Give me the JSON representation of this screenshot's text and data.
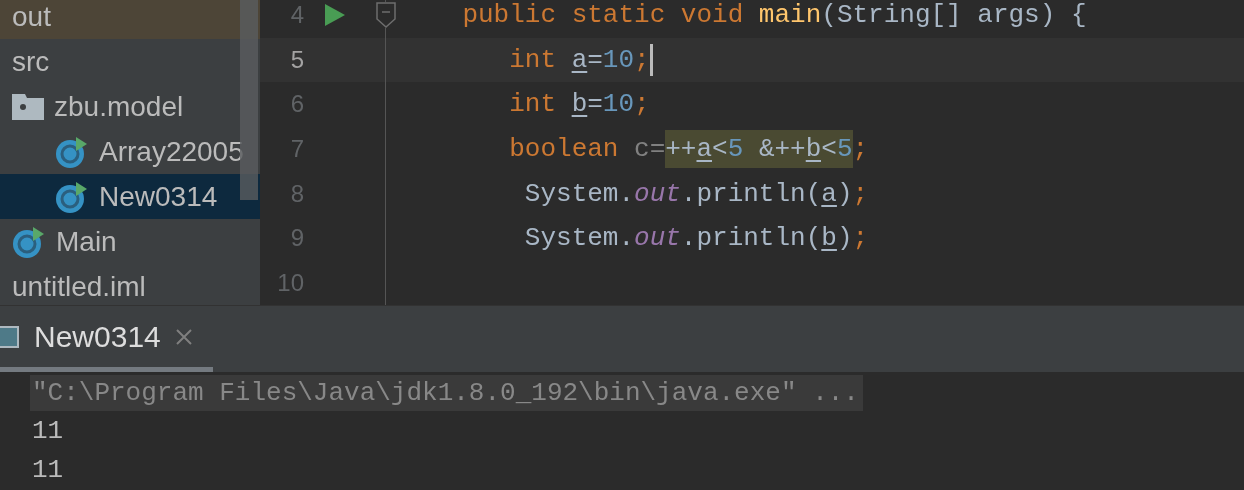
{
  "project_tree": [
    {
      "label": "out",
      "selected": false,
      "excluded": true
    },
    {
      "label": "src",
      "selected": false,
      "children": [
        {
          "label": "zbu.model",
          "kind": "package",
          "selected": false,
          "children": [
            {
              "label": "Array22005",
              "kind": "runnable-class",
              "selected": false
            },
            {
              "label": "New0314",
              "kind": "runnable-class",
              "selected": true
            }
          ]
        },
        {
          "label": "Main",
          "kind": "runnable-class",
          "selected": false
        }
      ]
    },
    {
      "label": "untitled.iml",
      "selected": false
    }
  ],
  "editor": {
    "lines": [
      {
        "number": "4",
        "run": true,
        "fold": true,
        "current": false,
        "tokens": [
          {
            "text": "    public static void ",
            "kind": "keyword"
          },
          {
            "text": "main",
            "kind": "method"
          },
          {
            "text": "(String[] args) {",
            "kind": "plain"
          }
        ]
      },
      {
        "number": "5",
        "current": true,
        "caret": true,
        "tokens": [
          {
            "text": "       int ",
            "kind": "keyword"
          },
          {
            "text": "a",
            "kind": "variable"
          },
          {
            "text": "=",
            "kind": "plain"
          },
          {
            "text": "10",
            "kind": "number"
          },
          {
            "text": ";",
            "kind": "punct"
          }
        ]
      },
      {
        "number": "6",
        "current": false,
        "tokens": [
          {
            "text": "       int ",
            "kind": "keyword"
          },
          {
            "text": "b",
            "kind": "variable"
          },
          {
            "text": "=",
            "kind": "plain"
          },
          {
            "text": "10",
            "kind": "number"
          },
          {
            "text": ";",
            "kind": "punct"
          }
        ]
      },
      {
        "number": "7",
        "current": false,
        "tokens": [
          {
            "text": "       boolean ",
            "kind": "keyword"
          },
          {
            "text": "c=",
            "kind": "unused"
          },
          {
            "text": "++",
            "kind": "plain",
            "highlight": true
          },
          {
            "text": "a",
            "kind": "variable",
            "highlight": true
          },
          {
            "text": "<",
            "kind": "plain",
            "highlight": true
          },
          {
            "text": "5",
            "kind": "number",
            "highlight": true
          },
          {
            "text": " &++",
            "kind": "plain",
            "highlight": true
          },
          {
            "text": "b",
            "kind": "variable",
            "highlight": true
          },
          {
            "text": "<",
            "kind": "plain",
            "highlight": true
          },
          {
            "text": "5",
            "kind": "number",
            "highlight": true
          },
          {
            "text": ";",
            "kind": "punct"
          }
        ]
      },
      {
        "number": "8",
        "current": false,
        "tokens": [
          {
            "text": "        System.",
            "kind": "plain"
          },
          {
            "text": "out",
            "kind": "field"
          },
          {
            "text": ".println(",
            "kind": "plain"
          },
          {
            "text": "a",
            "kind": "variable"
          },
          {
            "text": ")",
            "kind": "plain"
          },
          {
            "text": ";",
            "kind": "punct"
          }
        ]
      },
      {
        "number": "9",
        "current": false,
        "tokens": [
          {
            "text": "        System.",
            "kind": "plain"
          },
          {
            "text": "out",
            "kind": "field"
          },
          {
            "text": ".println(",
            "kind": "plain"
          },
          {
            "text": "b",
            "kind": "variable"
          },
          {
            "text": ")",
            "kind": "plain"
          },
          {
            "text": ";",
            "kind": "punct"
          }
        ]
      },
      {
        "number": "10",
        "current": false
      }
    ]
  },
  "run_panel": {
    "tabs": [
      {
        "label": "New0314",
        "selected": true,
        "closable": true
      }
    ],
    "console": [
      {
        "text": "\"C:\\Program Files\\Java\\jdk1.8.0_192\\bin\\java.exe\" ...",
        "kind": "command"
      },
      {
        "text": "11",
        "kind": "output"
      },
      {
        "text": "11",
        "kind": "output"
      }
    ]
  }
}
